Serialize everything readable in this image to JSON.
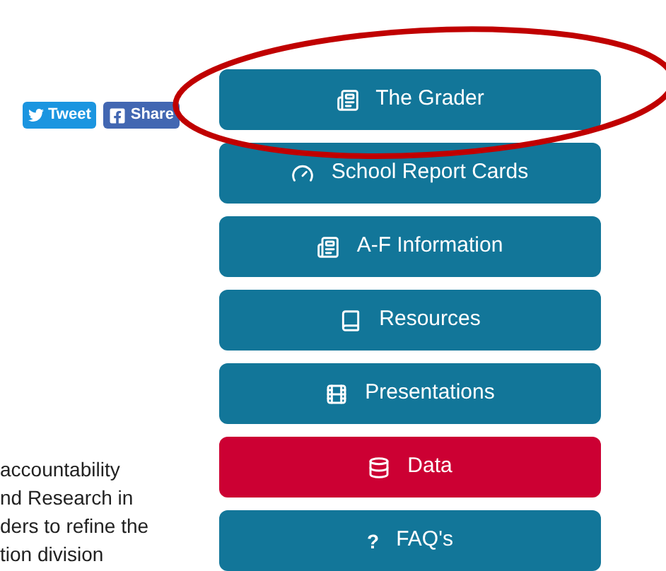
{
  "share_buttons": [
    {
      "kind": "twitter",
      "label": "Tweet"
    },
    {
      "kind": "facebook",
      "label": "Share"
    }
  ],
  "menu": [
    {
      "kind": "newspaper",
      "label": "The Grader",
      "selected": false
    },
    {
      "kind": "gauge",
      "label": "School Report Cards",
      "selected": false
    },
    {
      "kind": "newspaper",
      "label": "A-F Information",
      "selected": false
    },
    {
      "kind": "book",
      "label": "Resources",
      "selected": false
    },
    {
      "kind": "film",
      "label": "Presentations",
      "selected": false
    },
    {
      "kind": "database",
      "label": "Data",
      "selected": true
    },
    {
      "kind": "question",
      "label": "FAQ's",
      "selected": false,
      "glyph": "?"
    }
  ],
  "body_text_lines": [
    "accountability",
    "nd Research in",
    "ders to refine the",
    "tion division"
  ],
  "annotation": {
    "kind": "ellipse",
    "color": "#c00000"
  }
}
